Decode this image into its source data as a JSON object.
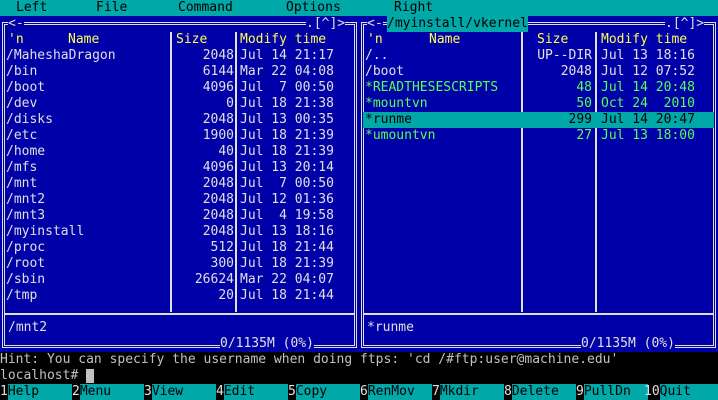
{
  "menubar": [
    "Left",
    "File",
    "Command",
    "Options",
    "Right"
  ],
  "left_panel": {
    "controls_left": "<-",
    "controls_right": ".[^]>",
    "headers": {
      "name_flag": "'n",
      "name": "Name",
      "size": "Size",
      "modify": "Modify time"
    },
    "files": [
      {
        "name": "/MaheshaDragon",
        "size": "2048",
        "mtime": "Jul 14 21:17"
      },
      {
        "name": "/bin",
        "size": "6144",
        "mtime": "Mar 22 04:08"
      },
      {
        "name": "/boot",
        "size": "4096",
        "mtime": "Jul  7 00:50"
      },
      {
        "name": "/dev",
        "size": "0",
        "mtime": "Jul 18 21:38"
      },
      {
        "name": "/disks",
        "size": "2048",
        "mtime": "Jul 13 00:35"
      },
      {
        "name": "/etc",
        "size": "1900",
        "mtime": "Jul 18 21:39"
      },
      {
        "name": "/home",
        "size": "40",
        "mtime": "Jul 18 21:39"
      },
      {
        "name": "/mfs",
        "size": "4096",
        "mtime": "Jul 13 20:14"
      },
      {
        "name": "/mnt",
        "size": "2048",
        "mtime": "Jul  7 00:50"
      },
      {
        "name": "/mnt2",
        "size": "2048",
        "mtime": "Jul 12 01:36"
      },
      {
        "name": "/mnt3",
        "size": "2048",
        "mtime": "Jul  4 19:58"
      },
      {
        "name": "/myinstall",
        "size": "2048",
        "mtime": "Jul 13 18:16"
      },
      {
        "name": "/proc",
        "size": "512",
        "mtime": "Jul 18 21:44"
      },
      {
        "name": "/root",
        "size": "300",
        "mtime": "Jul 18 21:39"
      },
      {
        "name": "/sbin",
        "size": "26624",
        "mtime": "Mar 22 04:07"
      },
      {
        "name": "/tmp",
        "size": "20",
        "mtime": "Jul 18 21:44"
      }
    ],
    "mini_info": "/mnt2",
    "free": "0/1135M (0%)"
  },
  "right_panel": {
    "controls_left": "<-",
    "path": "/myinstall/vkernel",
    "controls_right": ".[^]>",
    "headers": {
      "name_flag": "'n",
      "name": "Name",
      "size": "Size",
      "modify": "Modify time"
    },
    "files": [
      {
        "name": "/..",
        "size": "UP--DIR",
        "mtime": "Jul 13 18:16",
        "exec": false
      },
      {
        "name": "/boot",
        "size": "2048",
        "mtime": "Jul 12 07:52",
        "exec": false
      },
      {
        "name": "*READTHESESCRIPTS",
        "size": "48",
        "mtime": "Jul 14 20:48",
        "exec": true
      },
      {
        "name": "*mountvn",
        "size": "50",
        "mtime": "Oct 24  2010",
        "exec": true
      },
      {
        "name": "*runme",
        "size": "299",
        "mtime": "Jul 14 20:47",
        "exec": true,
        "selected": true
      },
      {
        "name": "*umountvn",
        "size": "27",
        "mtime": "Jul 13 18:00",
        "exec": true
      }
    ],
    "mini_info": "*runme",
    "free": "0/1135M (0%)"
  },
  "hint": "Hint: You can specify the username when doing ftps: 'cd /#ftp:user@machine.edu'",
  "prompt": "localhost#",
  "keybar": [
    {
      "num": "1",
      "label": "Help"
    },
    {
      "num": "2",
      "label": "Menu"
    },
    {
      "num": "3",
      "label": "View"
    },
    {
      "num": "4",
      "label": "Edit"
    },
    {
      "num": "5",
      "label": "Copy"
    },
    {
      "num": "6",
      "label": "RenMov"
    },
    {
      "num": "7",
      "label": "Mkdir"
    },
    {
      "num": "8",
      "label": "Delete"
    },
    {
      "num": "9",
      "label": "PullDn"
    },
    {
      "num": "10",
      "label": "Quit"
    }
  ],
  "colors": {
    "panel_bg": "#0000a8",
    "accent": "#00a8a8",
    "header": "#ffff55",
    "exec": "#55ff55"
  }
}
